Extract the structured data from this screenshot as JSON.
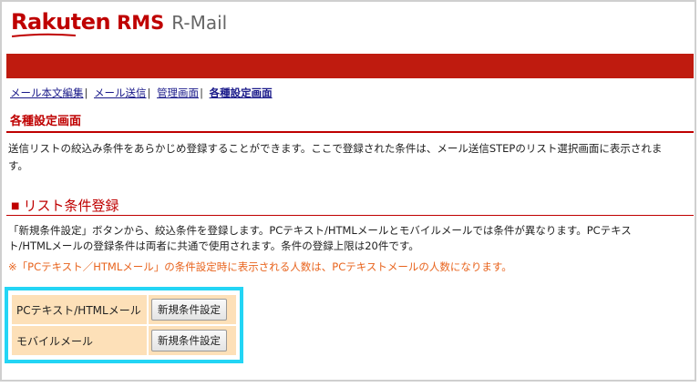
{
  "header": {
    "logo_brand": "Rakuten",
    "logo_rms": "RMS",
    "logo_product": "R-Mail",
    "brand_color": "#bf0000"
  },
  "nav": {
    "items": [
      {
        "label": "メール本文編集",
        "current": false
      },
      {
        "label": "メール送信",
        "current": false
      },
      {
        "label": "管理画面",
        "current": false
      },
      {
        "label": "各種設定画面",
        "current": true
      }
    ],
    "separator": "|"
  },
  "page": {
    "title": "各種設定画面",
    "description": "送信リストの絞込み条件をあらかじめ登録することができます。ここで登録された条件は、メール送信STEPのリスト選択画面に表示されます。"
  },
  "section": {
    "marker": "■",
    "title": "リスト条件登録",
    "body": "「新規条件設定」ボタンから、絞込条件を登録します。PCテキスト/HTMLメールとモバイルメールでは条件が異なります。PCテキスト/HTMLメールの登録条件は両者に共通で使用されます。条件の登録上限は20件です。",
    "note": "※「PCテキスト／HTMLメール」の条件設定時に表示される人数は、PCテキストメールの人数になります。",
    "note_color": "#e8641e"
  },
  "conditions": {
    "rows": [
      {
        "label": "PCテキスト/HTMLメール",
        "button": "新規条件設定"
      },
      {
        "label": "モバイルメール",
        "button": "新規条件設定"
      }
    ],
    "highlight_color": "#23d5f5"
  }
}
